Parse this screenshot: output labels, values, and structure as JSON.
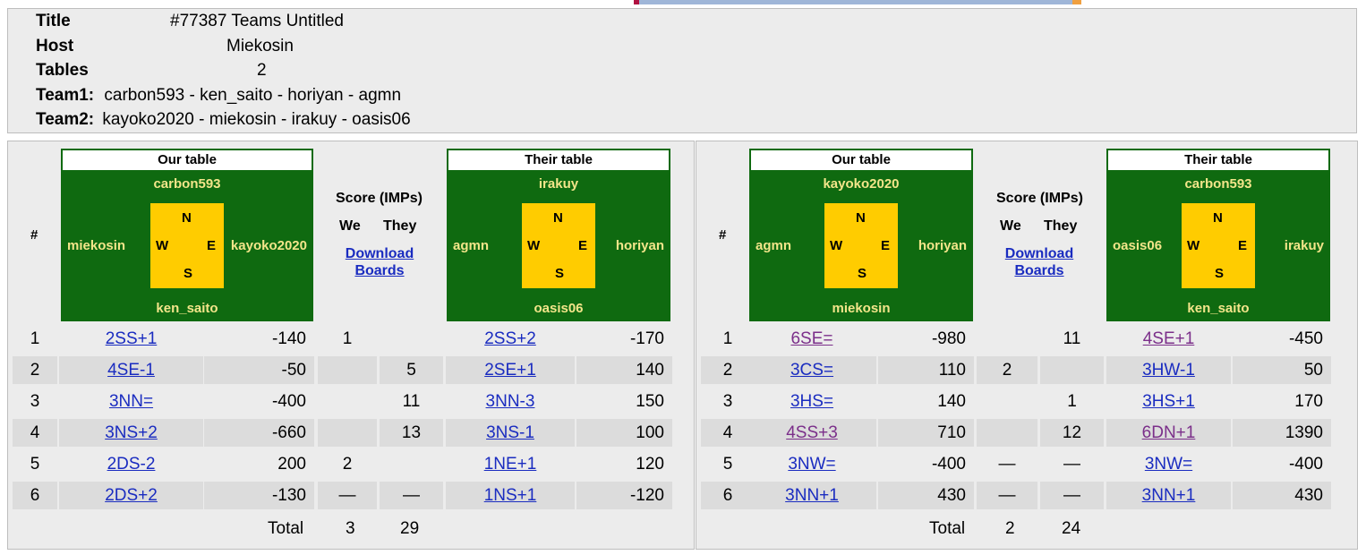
{
  "info": {
    "title_label": "Title",
    "title_value": "#77387 Teams Untitled",
    "host_label": "Host",
    "host_value": "Miekosin",
    "tables_label": "Tables",
    "tables_value": "2",
    "team1_label": "Team1:",
    "team1_value": "carbon593 - ken_saito - horiyan - agmn",
    "team2_label": "Team2:",
    "team2_value": "kayoko2020 - miekosin - irakuy - oasis06"
  },
  "compass": {
    "n": "N",
    "s": "S",
    "e": "E",
    "w": "W"
  },
  "colors": {
    "table_green": "#0f6a10",
    "compass_yellow": "#ffcc00",
    "player_name": "#f3e58a",
    "link": "#1a2cc0",
    "visited_link": "#7b2f8a"
  },
  "panels": [
    {
      "hash": "#",
      "score_label": "Score (IMPs)",
      "we_label": "We",
      "they_label": "They",
      "download_line1": "Download",
      "download_line2": "Boards",
      "our_table": {
        "title": "Our table",
        "north": "carbon593",
        "south": "ken_saito",
        "west": "miekosin",
        "east": "kayoko2020"
      },
      "their_table": {
        "title": "Their table",
        "north": "irakuy",
        "south": "oasis06",
        "west": "agmn",
        "east": "horiyan"
      },
      "rows": [
        {
          "num": "1",
          "our_contract": "2SS+1",
          "our_score": "-140",
          "we": "1",
          "they": "",
          "their_contract": "2SS+2",
          "their_score": "-170"
        },
        {
          "num": "2",
          "our_contract": "4SE-1",
          "our_score": "-50",
          "we": "",
          "they": "5",
          "their_contract": "2SE+1",
          "their_score": "140"
        },
        {
          "num": "3",
          "our_contract": "3NN=",
          "our_score": "-400",
          "we": "",
          "they": "11",
          "their_contract": "3NN-3",
          "their_score": "150"
        },
        {
          "num": "4",
          "our_contract": "3NS+2",
          "our_score": "-660",
          "we": "",
          "they": "13",
          "their_contract": "3NS-1",
          "their_score": "100"
        },
        {
          "num": "5",
          "our_contract": "2DS-2",
          "our_score": "200",
          "we": "2",
          "they": "",
          "their_contract": "1NE+1",
          "their_score": "120"
        },
        {
          "num": "6",
          "our_contract": "2DS+2",
          "our_score": "-130",
          "we": "—",
          "they": "—",
          "their_contract": "1NS+1",
          "their_score": "-120"
        }
      ],
      "total_label": "Total",
      "total_we": "3",
      "total_they": "29"
    },
    {
      "hash": "#",
      "score_label": "Score (IMPs)",
      "we_label": "We",
      "they_label": "They",
      "download_line1": "Download",
      "download_line2": "Boards",
      "our_table": {
        "title": "Our table",
        "north": "kayoko2020",
        "south": "miekosin",
        "west": "agmn",
        "east": "horiyan"
      },
      "their_table": {
        "title": "Their table",
        "north": "carbon593",
        "south": "ken_saito",
        "west": "oasis06",
        "east": "irakuy"
      },
      "rows": [
        {
          "num": "1",
          "our_contract": "6SE=",
          "our_score": "-980",
          "we": "",
          "they": "11",
          "their_contract": "4SE+1",
          "their_score": "-450"
        },
        {
          "num": "2",
          "our_contract": "3CS=",
          "our_score": "110",
          "we": "2",
          "they": "",
          "their_contract": "3HW-1",
          "their_score": "50"
        },
        {
          "num": "3",
          "our_contract": "3HS=",
          "our_score": "140",
          "we": "",
          "they": "1",
          "their_contract": "3HS+1",
          "their_score": "170"
        },
        {
          "num": "4",
          "our_contract": "4SS+3",
          "our_score": "710",
          "we": "",
          "they": "12",
          "their_contract": "6DN+1",
          "their_score": "1390"
        },
        {
          "num": "5",
          "our_contract": "3NW=",
          "our_score": "-400",
          "we": "—",
          "they": "—",
          "their_contract": "3NW=",
          "their_score": "-400"
        },
        {
          "num": "6",
          "our_contract": "3NN+1",
          "our_score": "430",
          "we": "—",
          "they": "—",
          "their_contract": "3NN+1",
          "their_score": "430"
        }
      ],
      "total_label": "Total",
      "total_we": "2",
      "total_they": "24"
    }
  ]
}
